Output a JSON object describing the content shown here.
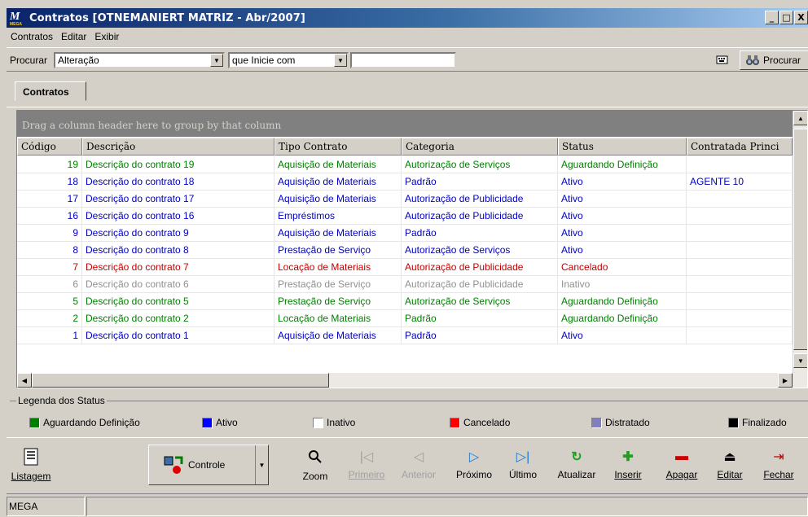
{
  "window": {
    "title": "Contratos [OTNEMANIERT MATRIZ - Abr/2007]",
    "logo_text": "M",
    "logo_sub": "MEGA",
    "min": "_",
    "max": "□",
    "close": "X"
  },
  "menu": [
    "Contratos",
    "Editar",
    "Exibir"
  ],
  "search": {
    "label": "Procurar",
    "field_value": "Alteração",
    "mode_value": "que Inicie com",
    "text_value": "",
    "button_label": "Procurar"
  },
  "tab": {
    "label": "Contratos"
  },
  "grid": {
    "group_hint": "Drag a column header here to group by that column",
    "columns": [
      "Código",
      "Descrição",
      "Tipo Contrato",
      "Categoria",
      "Status",
      "Contratada Princi"
    ],
    "rows": [
      {
        "codigo": "19",
        "descricao": "Descrição do contrato 19",
        "tipo": "Aquisição de Materiais",
        "categoria": "Autorização de Serviços",
        "status": "Aguardando Definição",
        "contratada": "",
        "color": "green"
      },
      {
        "codigo": "18",
        "descricao": "Descrição do contrato 18",
        "tipo": "Aquisição de Materiais",
        "categoria": "Padrão",
        "status": "Ativo",
        "contratada": "AGENTE 10",
        "color": "blue"
      },
      {
        "codigo": "17",
        "descricao": "Descrição do contrato 17",
        "tipo": "Aquisição de Materiais",
        "categoria": "Autorização de Publicidade",
        "status": "Ativo",
        "contratada": "",
        "color": "blue"
      },
      {
        "codigo": "16",
        "descricao": "Descrição do contrato 16",
        "tipo": "Empréstimos",
        "categoria": "Autorização de Publicidade",
        "status": "Ativo",
        "contratada": "",
        "color": "blue"
      },
      {
        "codigo": "9",
        "descricao": "Descrição do contrato 9",
        "tipo": "Aquisição de Materiais",
        "categoria": "Padrão",
        "status": "Ativo",
        "contratada": "",
        "color": "blue"
      },
      {
        "codigo": "8",
        "descricao": "Descrição do contrato 8",
        "tipo": "Prestação de Serviço",
        "categoria": "Autorização de Serviços",
        "status": "Ativo",
        "contratada": "",
        "color": "blue"
      },
      {
        "codigo": "7",
        "descricao": "Descrição do contrato 7",
        "tipo": "Locação de Materiais",
        "categoria": "Autorização de Publicidade",
        "status": "Cancelado",
        "contratada": "",
        "color": "red"
      },
      {
        "codigo": "6",
        "descricao": "Descrição do contrato 6",
        "tipo": "Prestação de Serviço",
        "categoria": "Autorização de Publicidade",
        "status": "Inativo",
        "contratada": "",
        "color": "gray"
      },
      {
        "codigo": "5",
        "descricao": "Descrição do contrato 5",
        "tipo": "Prestação de Serviço",
        "categoria": "Autorização de Serviços",
        "status": "Aguardando Definição",
        "contratada": "",
        "color": "green"
      },
      {
        "codigo": "2",
        "descricao": "Descrição do contrato 2",
        "tipo": "Locação de Materiais",
        "categoria": "Padrão",
        "status": "Aguardando Definição",
        "contratada": "",
        "color": "green"
      },
      {
        "codigo": "1",
        "descricao": "Descrição do contrato 1",
        "tipo": "Aquisição de Materiais",
        "categoria": "Padrão",
        "status": "Ativo",
        "contratada": "",
        "color": "blue"
      }
    ]
  },
  "legend": {
    "title": "Legenda dos Status",
    "items": [
      {
        "label": "Aguardando Definição",
        "color": "#008000"
      },
      {
        "label": "Ativo",
        "color": "#0000ff"
      },
      {
        "label": "Inativo",
        "color": "#ffffff"
      },
      {
        "label": "Cancelado",
        "color": "#ff0000"
      },
      {
        "label": "Distratado",
        "color": "#8080c0"
      },
      {
        "label": "Finalizado",
        "color": "#000000"
      }
    ]
  },
  "toolbar": {
    "listagem": "Listagem",
    "controle": "Controle",
    "zoom": "Zoom",
    "primeiro": "Primeiro",
    "anterior": "Anterior",
    "proximo": "Próximo",
    "ultimo": "Último",
    "atualizar": "Atualizar",
    "inserir": "Inserir",
    "apagar": "Apagar",
    "editar": "Editar",
    "fechar": "Fechar"
  },
  "status": {
    "text": "MEGA"
  }
}
